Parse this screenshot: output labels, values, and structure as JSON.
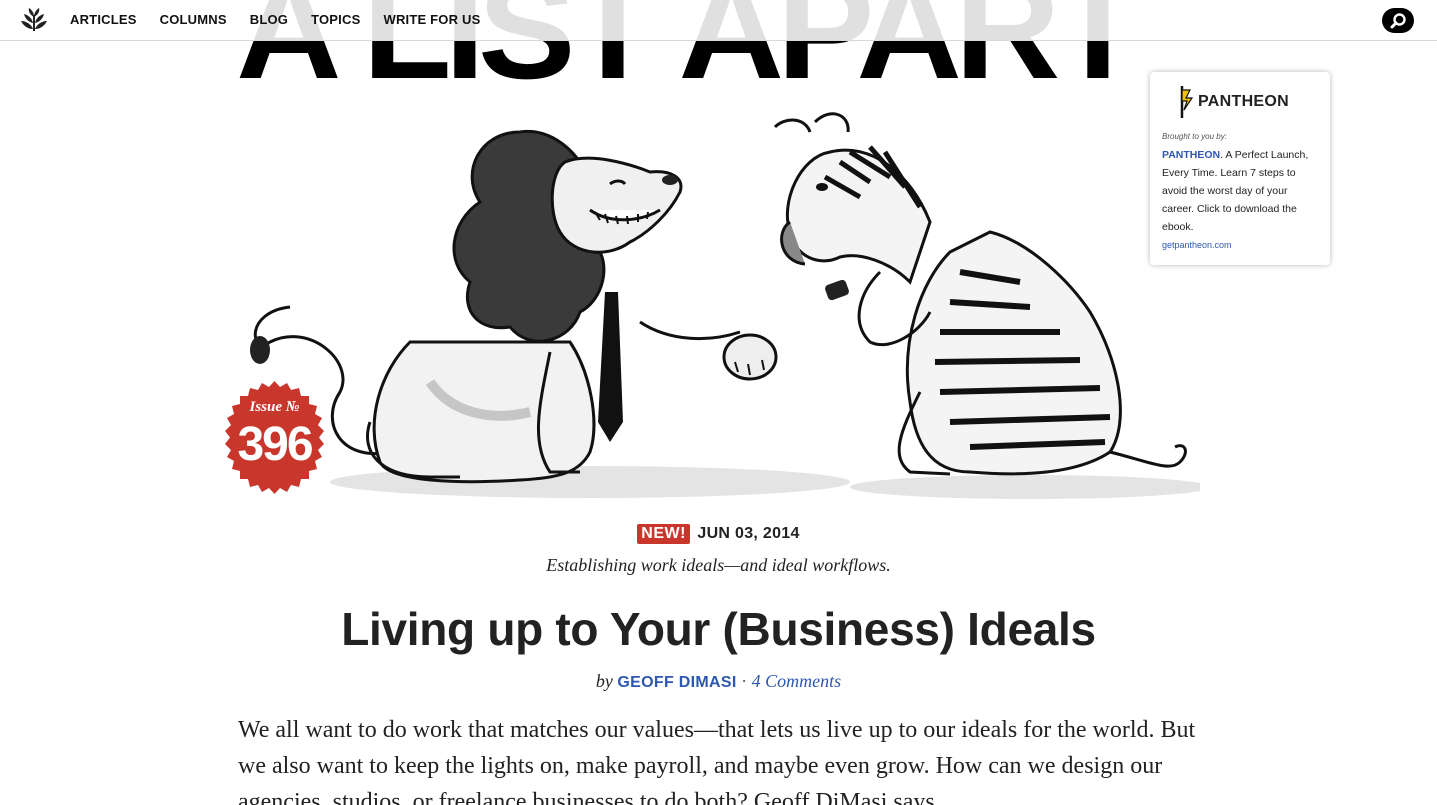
{
  "nav": {
    "logo_icon": "laurel-icon",
    "links": [
      "ARTICLES",
      "COLUMNS",
      "BLOG",
      "TOPICS",
      "WRITE FOR US"
    ],
    "search_icon": "search-icon"
  },
  "masthead": {
    "title": "A LIST APART"
  },
  "issue": {
    "label": "Issue №",
    "number": "396",
    "color": "#c9372c"
  },
  "sponsor": {
    "brand": "PANTHEON",
    "brought_by": "Brought to you by:",
    "link_name": "PANTHEON",
    "text": ". A Perfect Launch, Every Time. Learn 7 steps to avoid the worst day of your career. Click to download the ebook.",
    "url": "getpantheon.com"
  },
  "article": {
    "new_badge": "NEW!",
    "date": "JUN 03, 2014",
    "dek": "Establishing work ideals—and ideal workflows.",
    "title": "Living up to Your (Business) Ideals",
    "by": "by",
    "author": "GEOFF DIMASI",
    "separator": "·",
    "comments": "4 Comments",
    "body": "We all want to do work that matches our values—that lets us live up to our ideals for the world. But we also want to keep the lights on, make payroll, and maybe even grow. How can we design our agencies, studios, or freelance businesses to do both? Geoff DiMasi says"
  },
  "colors": {
    "accent_blue": "#2e58b0",
    "badge_red": "#c9372c"
  }
}
